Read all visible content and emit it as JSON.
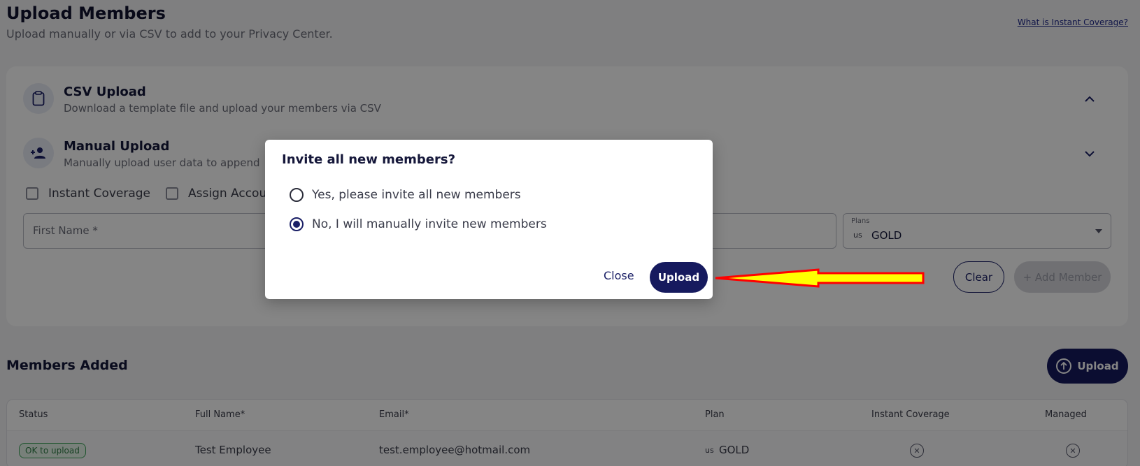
{
  "header": {
    "title": "Upload Members",
    "subtitle": "Upload manually or via CSV to add to your Privacy Center.",
    "help_link": "What is Instant Coverage?"
  },
  "sections": {
    "csv": {
      "title": "CSV Upload",
      "description": "Download a template file and upload your members via CSV",
      "icon": "clipboard-icon",
      "expanded": true
    },
    "manual": {
      "title": "Manual Upload",
      "description": "Manually upload user data to append",
      "icon": "add-person-icon",
      "expanded": false
    }
  },
  "form": {
    "checkboxes": [
      {
        "label": "Instant Coverage",
        "checked": false
      },
      {
        "label": "Assign Accou",
        "checked": false
      }
    ],
    "first_name_placeholder": "First Name *",
    "plans": {
      "label": "Plans",
      "flag": "us",
      "value": "GOLD"
    },
    "clear_label": "Clear",
    "add_member_label": "+ Add Member"
  },
  "members": {
    "title": "Members Added",
    "upload_label": "Upload",
    "columns": [
      "Status",
      "Full Name*",
      "Email*",
      "Plan",
      "Instant Coverage",
      "Managed"
    ],
    "rows": [
      {
        "status": "OK to upload",
        "full_name": "Test Employee",
        "email": "test.employee@hotmail.com",
        "plan_flag": "us",
        "plan": "GOLD"
      }
    ]
  },
  "modal": {
    "title": "Invite all new members?",
    "options": [
      {
        "label": "Yes, please invite all new members",
        "selected": false
      },
      {
        "label": "No, I will manually invite new members",
        "selected": true
      }
    ],
    "close_label": "Close",
    "upload_label": "Upload"
  },
  "annotation": {
    "arrow_color": "#ffff00",
    "arrow_outline": "#ff0000"
  },
  "colors": {
    "primary": "#161a5e",
    "success": "#3fa35a"
  }
}
